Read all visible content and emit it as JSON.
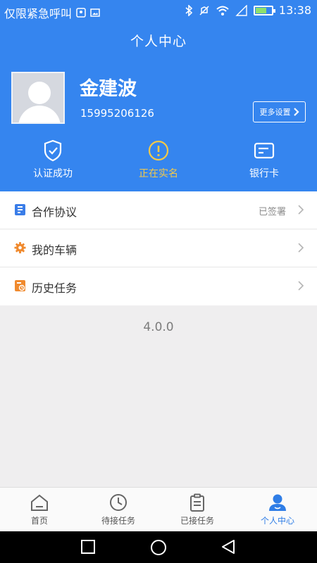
{
  "status_bar": {
    "carrier": "仅限紧急呼叫",
    "time": "13:38",
    "battery_level": 0.7
  },
  "header": {
    "title": "个人中心"
  },
  "profile": {
    "name": "金建波",
    "phone": "15995206126",
    "more_label": "更多设置"
  },
  "stats": [
    {
      "label": "认证成功",
      "icon": "shield-check-icon"
    },
    {
      "label": "正在实名",
      "icon": "alert-circle-icon"
    },
    {
      "label": "银行卡",
      "icon": "bank-card-icon"
    }
  ],
  "menu": [
    {
      "label": "合作协议",
      "value": "已签署",
      "icon": "agreement-icon"
    },
    {
      "label": "我的车辆",
      "value": "",
      "icon": "gear-icon"
    },
    {
      "label": "历史任务",
      "value": "",
      "icon": "history-icon"
    }
  ],
  "version": "4.0.0",
  "tabs": [
    {
      "label": "首页",
      "icon": "home-icon"
    },
    {
      "label": "待接任务",
      "icon": "clock-icon"
    },
    {
      "label": "已接任务",
      "icon": "clipboard-icon"
    },
    {
      "label": "个人中心",
      "icon": "user-icon",
      "active": true
    }
  ],
  "colors": {
    "primary": "#3585ef",
    "warning": "#f4c948",
    "active_tab": "#2f7de6"
  }
}
